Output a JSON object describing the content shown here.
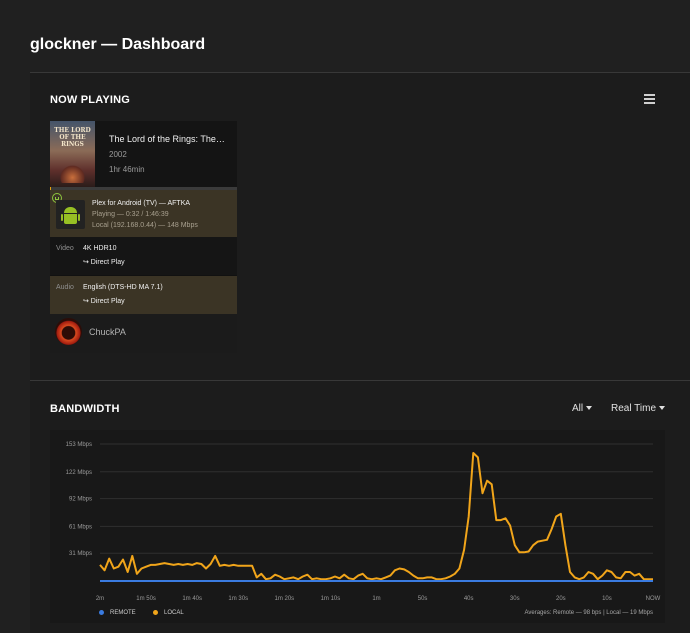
{
  "page": {
    "title": "glockner — Dashboard"
  },
  "now_playing": {
    "heading": "NOW PLAYING",
    "menu_icon": "list-icon",
    "media": {
      "poster_text": "THE LORD OF THE RINGS",
      "title": "The Lord of the Rings: The…",
      "year": "2002",
      "duration": "1hr 46min"
    },
    "progress": 0.003,
    "player": {
      "name": "Plex for Android (TV)  —  AFTKA",
      "state": "Playing — 0:32 / 1:46:39",
      "network": "Local (192.168.0.44) — 148 Mbps",
      "icon": "android-icon"
    },
    "video": {
      "label": "Video",
      "value": "4K HDR10",
      "decision": "↪  Direct Play"
    },
    "audio": {
      "label": "Audio",
      "value": "English (DTS-HD MA 7.1)",
      "decision": "↪  Direct Play"
    },
    "user": {
      "name": "ChuckPA"
    }
  },
  "bandwidth": {
    "heading": "BANDWIDTH",
    "filter_scope": "All",
    "filter_mode": "Real Time",
    "legend": {
      "remote": "REMOTE",
      "local": "LOCAL"
    },
    "averages": "Averages: Remote — 98 bps | Local — 19 Mbps",
    "colors": {
      "remote": "#3a7be0",
      "local": "#f1a51a"
    }
  },
  "chart_data": {
    "type": "line",
    "x_categories": [
      "2m",
      "1m 50s",
      "1m 40s",
      "1m 30s",
      "1m 20s",
      "1m 10s",
      "1m",
      "50s",
      "40s",
      "30s",
      "20s",
      "10s",
      "NOW"
    ],
    "y_ticks": [
      "153 Mbps",
      "122 Mbps",
      "92 Mbps",
      "61 Mbps",
      "31 Mbps"
    ],
    "ylim": [
      0,
      153
    ],
    "series": [
      {
        "name": "REMOTE",
        "x": [
          120,
          0
        ],
        "y": [
          0,
          0
        ]
      },
      {
        "name": "LOCAL",
        "x": [
          120,
          119,
          118,
          117,
          116,
          115,
          114,
          113,
          112,
          111,
          110,
          109,
          108,
          107,
          106,
          105,
          104,
          103,
          102,
          101,
          100,
          99,
          98,
          97,
          96,
          95,
          94,
          93,
          92,
          91,
          90,
          89,
          88,
          87,
          86,
          85,
          84,
          83,
          82,
          81,
          80,
          79,
          78,
          77,
          76,
          75,
          74,
          73,
          72,
          71,
          70,
          69,
          68,
          67,
          66,
          65,
          64,
          63,
          62,
          61,
          60,
          59,
          58,
          57,
          56,
          55,
          54,
          53,
          52,
          51,
          50,
          49,
          48,
          47,
          46,
          45,
          44,
          43,
          42,
          41,
          40,
          39,
          38,
          37,
          36,
          35,
          34,
          33,
          32,
          31,
          30,
          29,
          28,
          27,
          26,
          25,
          24,
          23,
          22,
          21,
          20,
          19,
          18,
          17,
          16,
          15,
          14,
          13,
          12,
          11,
          10,
          9,
          8,
          7,
          6,
          5,
          4,
          3,
          2,
          1,
          0
        ],
        "y": [
          18,
          12,
          25,
          14,
          16,
          24,
          10,
          28,
          8,
          14,
          16,
          18,
          18,
          19,
          20,
          19,
          18,
          19,
          18,
          19,
          18,
          20,
          19,
          14,
          19,
          28,
          17,
          18,
          17,
          18,
          17,
          17,
          17,
          17,
          4,
          8,
          2,
          3,
          7,
          5,
          2,
          3,
          4,
          2,
          5,
          7,
          2,
          3,
          2,
          2,
          3,
          5,
          3,
          7,
          3,
          2,
          6,
          8,
          3,
          2,
          3,
          2,
          4,
          6,
          12,
          14,
          13,
          10,
          6,
          3,
          3,
          4,
          4,
          2,
          2,
          3,
          5,
          8,
          14,
          35,
          72,
          143,
          138,
          98,
          112,
          108,
          68,
          68,
          70,
          62,
          40,
          32,
          32,
          33,
          40,
          44,
          45,
          46,
          58,
          72,
          75,
          40,
          10,
          4,
          2,
          4,
          10,
          8,
          2,
          6,
          12,
          10,
          4,
          3,
          10,
          10,
          6,
          8,
          2,
          2,
          2
        ]
      }
    ]
  }
}
